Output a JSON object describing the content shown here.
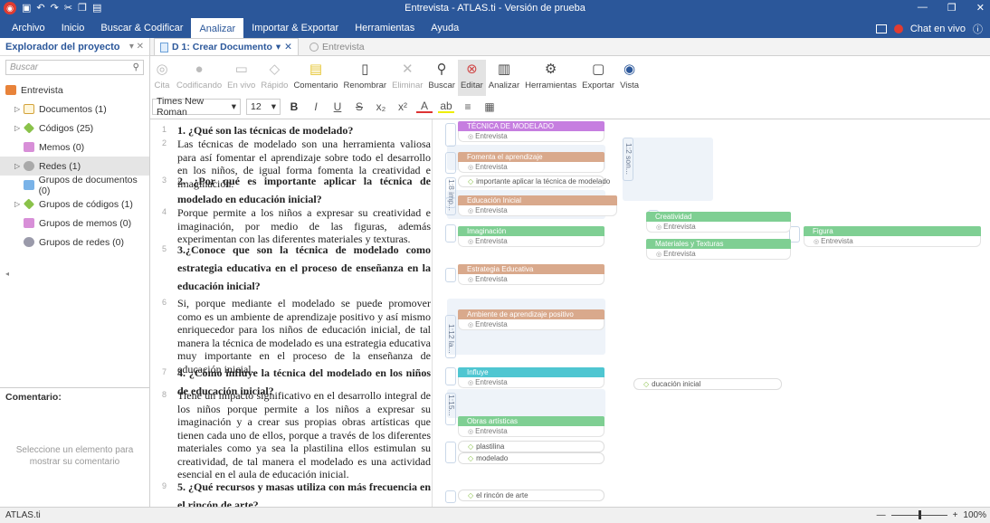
{
  "window": {
    "title": "Entrevista - ATLAS.ti - Versión de prueba"
  },
  "menu": {
    "tabs": [
      "Archivo",
      "Inicio",
      "Buscar & Codificar",
      "Analizar",
      "Importar & Exportar",
      "Herramientas",
      "Ayuda"
    ],
    "active_tab": "Analizar",
    "chat_label": "Chat en vivo"
  },
  "explorer": {
    "title": "Explorador del proyecto",
    "search_placeholder": "Buscar",
    "items": [
      {
        "label": "Entrevista",
        "icon": "project-icon"
      },
      {
        "label": "Documentos (1)",
        "icon": "document-icon"
      },
      {
        "label": "Códigos (25)",
        "icon": "code-icon"
      },
      {
        "label": "Memos (0)",
        "icon": "memo-icon"
      },
      {
        "label": "Redes (1)",
        "icon": "network-icon"
      },
      {
        "label": "Grupos de documentos (0)",
        "icon": "document-group-icon"
      },
      {
        "label": "Grupos de códigos (1)",
        "icon": "code-group-icon"
      },
      {
        "label": "Grupos de memos (0)",
        "icon": "memo-group-icon"
      },
      {
        "label": "Grupos de redes (0)",
        "icon": "network-group-icon"
      }
    ],
    "comment_label": "Comentario:",
    "comment_hint": "Seleccione un elemento para mostrar su comentario"
  },
  "doc_tabs": [
    {
      "label": "D 1: Crear Documento",
      "active": true
    },
    {
      "label": "Entrevista",
      "active": false
    }
  ],
  "ribbon": {
    "buttons": [
      {
        "label": "Cita",
        "icon": "quote-icon",
        "disabled": true
      },
      {
        "label": "Codificando",
        "icon": "coding-icon",
        "disabled": true
      },
      {
        "label": "En vivo",
        "icon": "live-icon",
        "disabled": true
      },
      {
        "label": "Rápido",
        "icon": "quick-icon",
        "disabled": true
      },
      {
        "label": "Comentario",
        "icon": "comment-icon",
        "disabled": false
      },
      {
        "label": "Renombrar",
        "icon": "rename-icon",
        "disabled": false
      },
      {
        "label": "Eliminar",
        "icon": "delete-icon",
        "disabled": true
      },
      {
        "label": "Buscar",
        "icon": "search-icon",
        "disabled": false
      },
      {
        "label": "Editar",
        "icon": "edit-icon",
        "disabled": false,
        "active": true
      },
      {
        "label": "Analizar",
        "icon": "analyze-icon",
        "disabled": false
      },
      {
        "label": "Herramientas",
        "icon": "tools-icon",
        "disabled": false
      },
      {
        "label": "Exportar",
        "icon": "export-icon",
        "disabled": false
      },
      {
        "label": "Vista",
        "icon": "view-icon",
        "disabled": false
      }
    ],
    "font_name": "Times New Roman",
    "font_size": "12"
  },
  "document": {
    "paragraphs": [
      {
        "num": "1",
        "kind": "q",
        "text": "1. ¿Qué son las técnicas de modelado?"
      },
      {
        "num": "2",
        "kind": "a",
        "text": "Las técnicas de modelado son una herramienta valiosa para así fomentar el aprendizaje sobre todo el desarrollo en los niños, de igual forma fomenta la creatividad e imaginación."
      },
      {
        "num": "3",
        "kind": "q",
        "text": "2. ¿Por qué es importante aplicar la técnica de modelado en educación inicial?"
      },
      {
        "num": "4",
        "kind": "a",
        "text": "Porque permite a los niños a expresar su creatividad e imaginación, por medio de las figuras, además experimentan con las diferentes materiales y texturas."
      },
      {
        "num": "5",
        "kind": "q",
        "text": "3.¿Conoce que son la técnica de modelado como estrategia educativa en el proceso de enseñanza en la educación inicial?"
      },
      {
        "num": "6",
        "kind": "a",
        "text": "Si, porque mediante el modelado se puede promover como es un ambiente de aprendizaje positivo y así mismo enriquecedor para los niños de educación inicial, de tal manera la técnica de modelado es una estrategia educativa muy importante en el proceso de la enseñanza de educación inicial."
      },
      {
        "num": "7",
        "kind": "q",
        "text": "4. ¿Cómo influye la técnica del modelado en los niños de educación inicial?"
      },
      {
        "num": "8",
        "kind": "a",
        "text": "Tiene un impacto significativo en el desarrollo integral de los niños porque permite a los niños a expresar su imaginación y a crear sus propias obras artísticas que tienen cada uno de ellos, porque a través de los diferentes materiales como ya sea la plastilina ellos estimulan su creatividad, de tal manera el modelado es una actividad esencial en el aula de educación inicial."
      },
      {
        "num": "9",
        "kind": "q",
        "text": "5. ¿Qué recursos y masas utiliza con más frecuencia en el rincón de arte?"
      }
    ]
  },
  "margin": {
    "codes": [
      {
        "label": "TÉCNICA DE MODELADO",
        "sub": "Entrevista",
        "color": "#c67ee0"
      },
      {
        "label": "Fomenta el aprendizaje",
        "sub": "Entrevista",
        "color": "#d9a98c"
      },
      {
        "label": "Educación Inicial",
        "sub": "Entrevista",
        "color": "#d9a98c"
      },
      {
        "label": "Imaginación",
        "sub": "Entrevista",
        "color": "#7fcf93"
      },
      {
        "label": "Creatividad",
        "sub": "Entrevista",
        "color": "#7fcf93"
      },
      {
        "label": "Materiales y Texturas",
        "sub": "Entrevista",
        "color": "#7fcf93"
      },
      {
        "label": "Figura",
        "sub": "Entrevista",
        "color": "#7fcf93"
      },
      {
        "label": "Estrategia Educativa",
        "sub": "Entrevista",
        "color": "#d9a98c"
      },
      {
        "label": "Ambiente de aprendizaje positivo",
        "sub": "Entrevista",
        "color": "#d9a98c"
      },
      {
        "label": "Influye",
        "sub": "Entrevista",
        "color": "#4fc6d1"
      },
      {
        "label": "Obras artísticas",
        "sub": "Entrevista",
        "color": "#7fcf93"
      }
    ],
    "single_codes": [
      "importante aplicar la técnica de modelado",
      "ducación inicial",
      "plastilina",
      "modelado",
      "el rincón de arte"
    ],
    "quote_labels": [
      "1:2 son...",
      "1:8 imp...",
      "1:12 la...",
      "1:15..."
    ]
  },
  "status": {
    "app_label": "ATLAS.ti",
    "zoom_value": "100%",
    "zoom_fraction": 0.5
  }
}
